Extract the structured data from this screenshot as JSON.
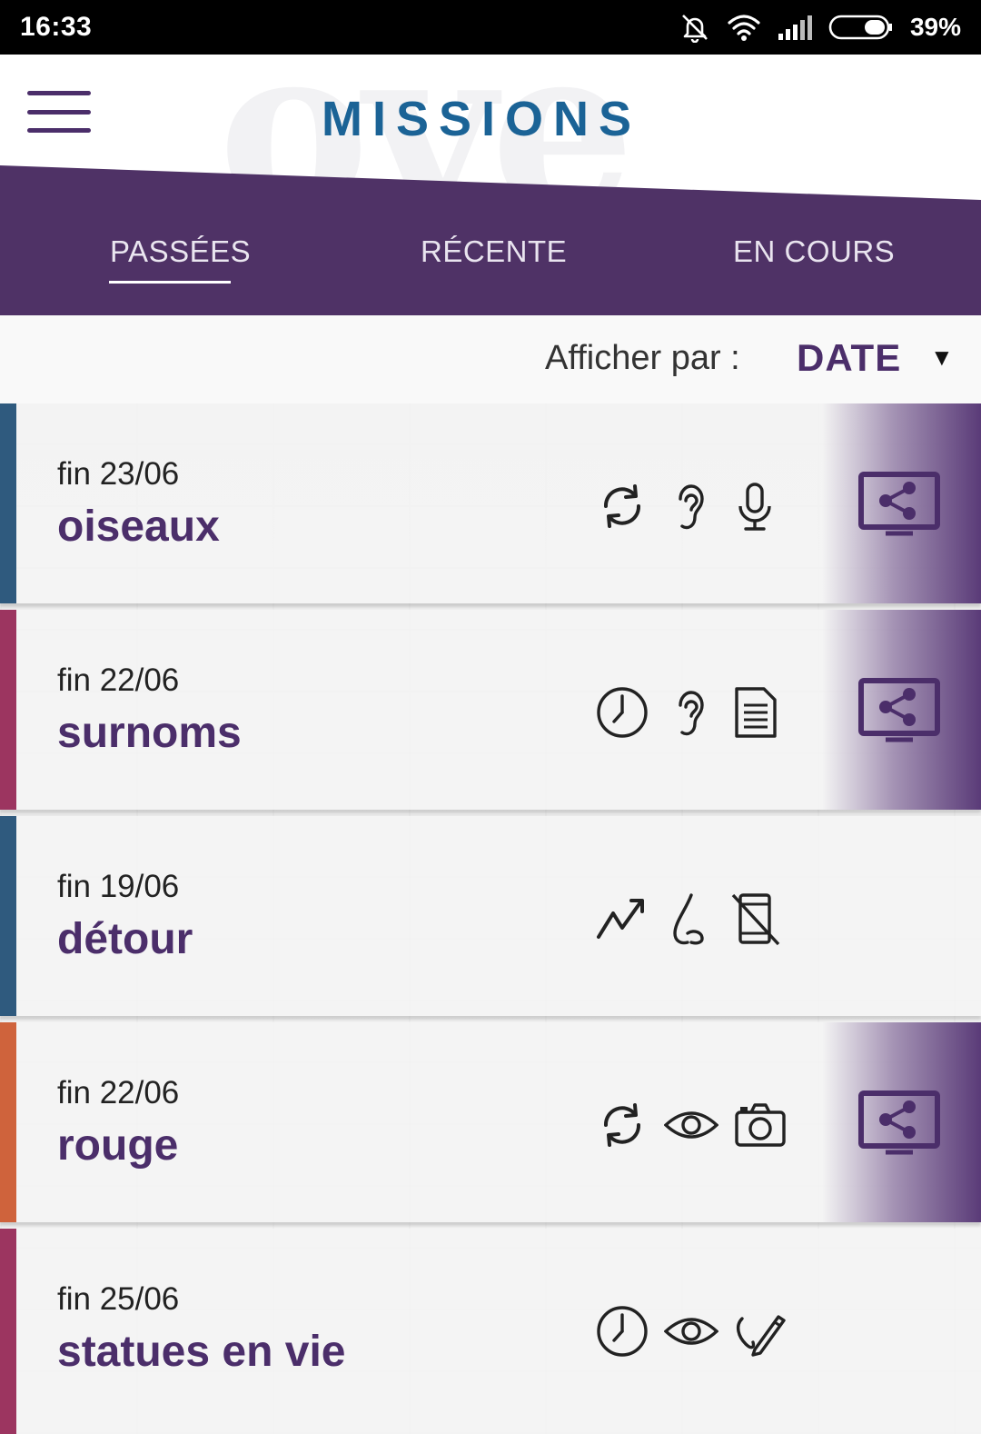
{
  "status_bar": {
    "time": "16:33",
    "battery": "39%",
    "icons": [
      "mute-icon",
      "wifi-icon",
      "signal-icon",
      "battery-icon"
    ]
  },
  "header": {
    "title": "MISSIONS",
    "watermark": "ove"
  },
  "tabs": [
    {
      "label": "PASSÉES",
      "active": true
    },
    {
      "label": "RÉCENTE",
      "active": false
    },
    {
      "label": "EN COURS",
      "active": false
    }
  ],
  "sort": {
    "label": "Afficher par :",
    "value": "DATE"
  },
  "colors": {
    "purple": "#4b2e6a",
    "band": "#4f3266",
    "title_blue": "#1b6396",
    "stripe_blue": "#2f5a7e",
    "stripe_red": "#9c3560",
    "stripe_orange": "#cf633c"
  },
  "missions": [
    {
      "date": "fin 23/06",
      "name": "oiseaux",
      "stripe": "#2f5a7e",
      "icons": [
        "refresh-icon",
        "ear-icon",
        "microphone-icon"
      ],
      "shareable": true
    },
    {
      "date": "fin 22/06",
      "name": "surnoms",
      "stripe": "#9c3560",
      "icons": [
        "clock-icon",
        "ear-icon",
        "document-icon"
      ],
      "shareable": true
    },
    {
      "date": "fin 19/06",
      "name": "détour",
      "stripe": "#2f5a7e",
      "icons": [
        "trend-icon",
        "nose-icon",
        "no-phone-icon"
      ],
      "shareable": false
    },
    {
      "date": "fin 22/06",
      "name": "rouge",
      "stripe": "#cf633c",
      "icons": [
        "refresh-icon",
        "eye-icon",
        "camera-icon"
      ],
      "shareable": true
    },
    {
      "date": "fin 25/06",
      "name": "statues en vie",
      "stripe": "#9c3560",
      "icons": [
        "clock-icon",
        "eye-icon",
        "pencil-icon"
      ],
      "shareable": false
    }
  ]
}
